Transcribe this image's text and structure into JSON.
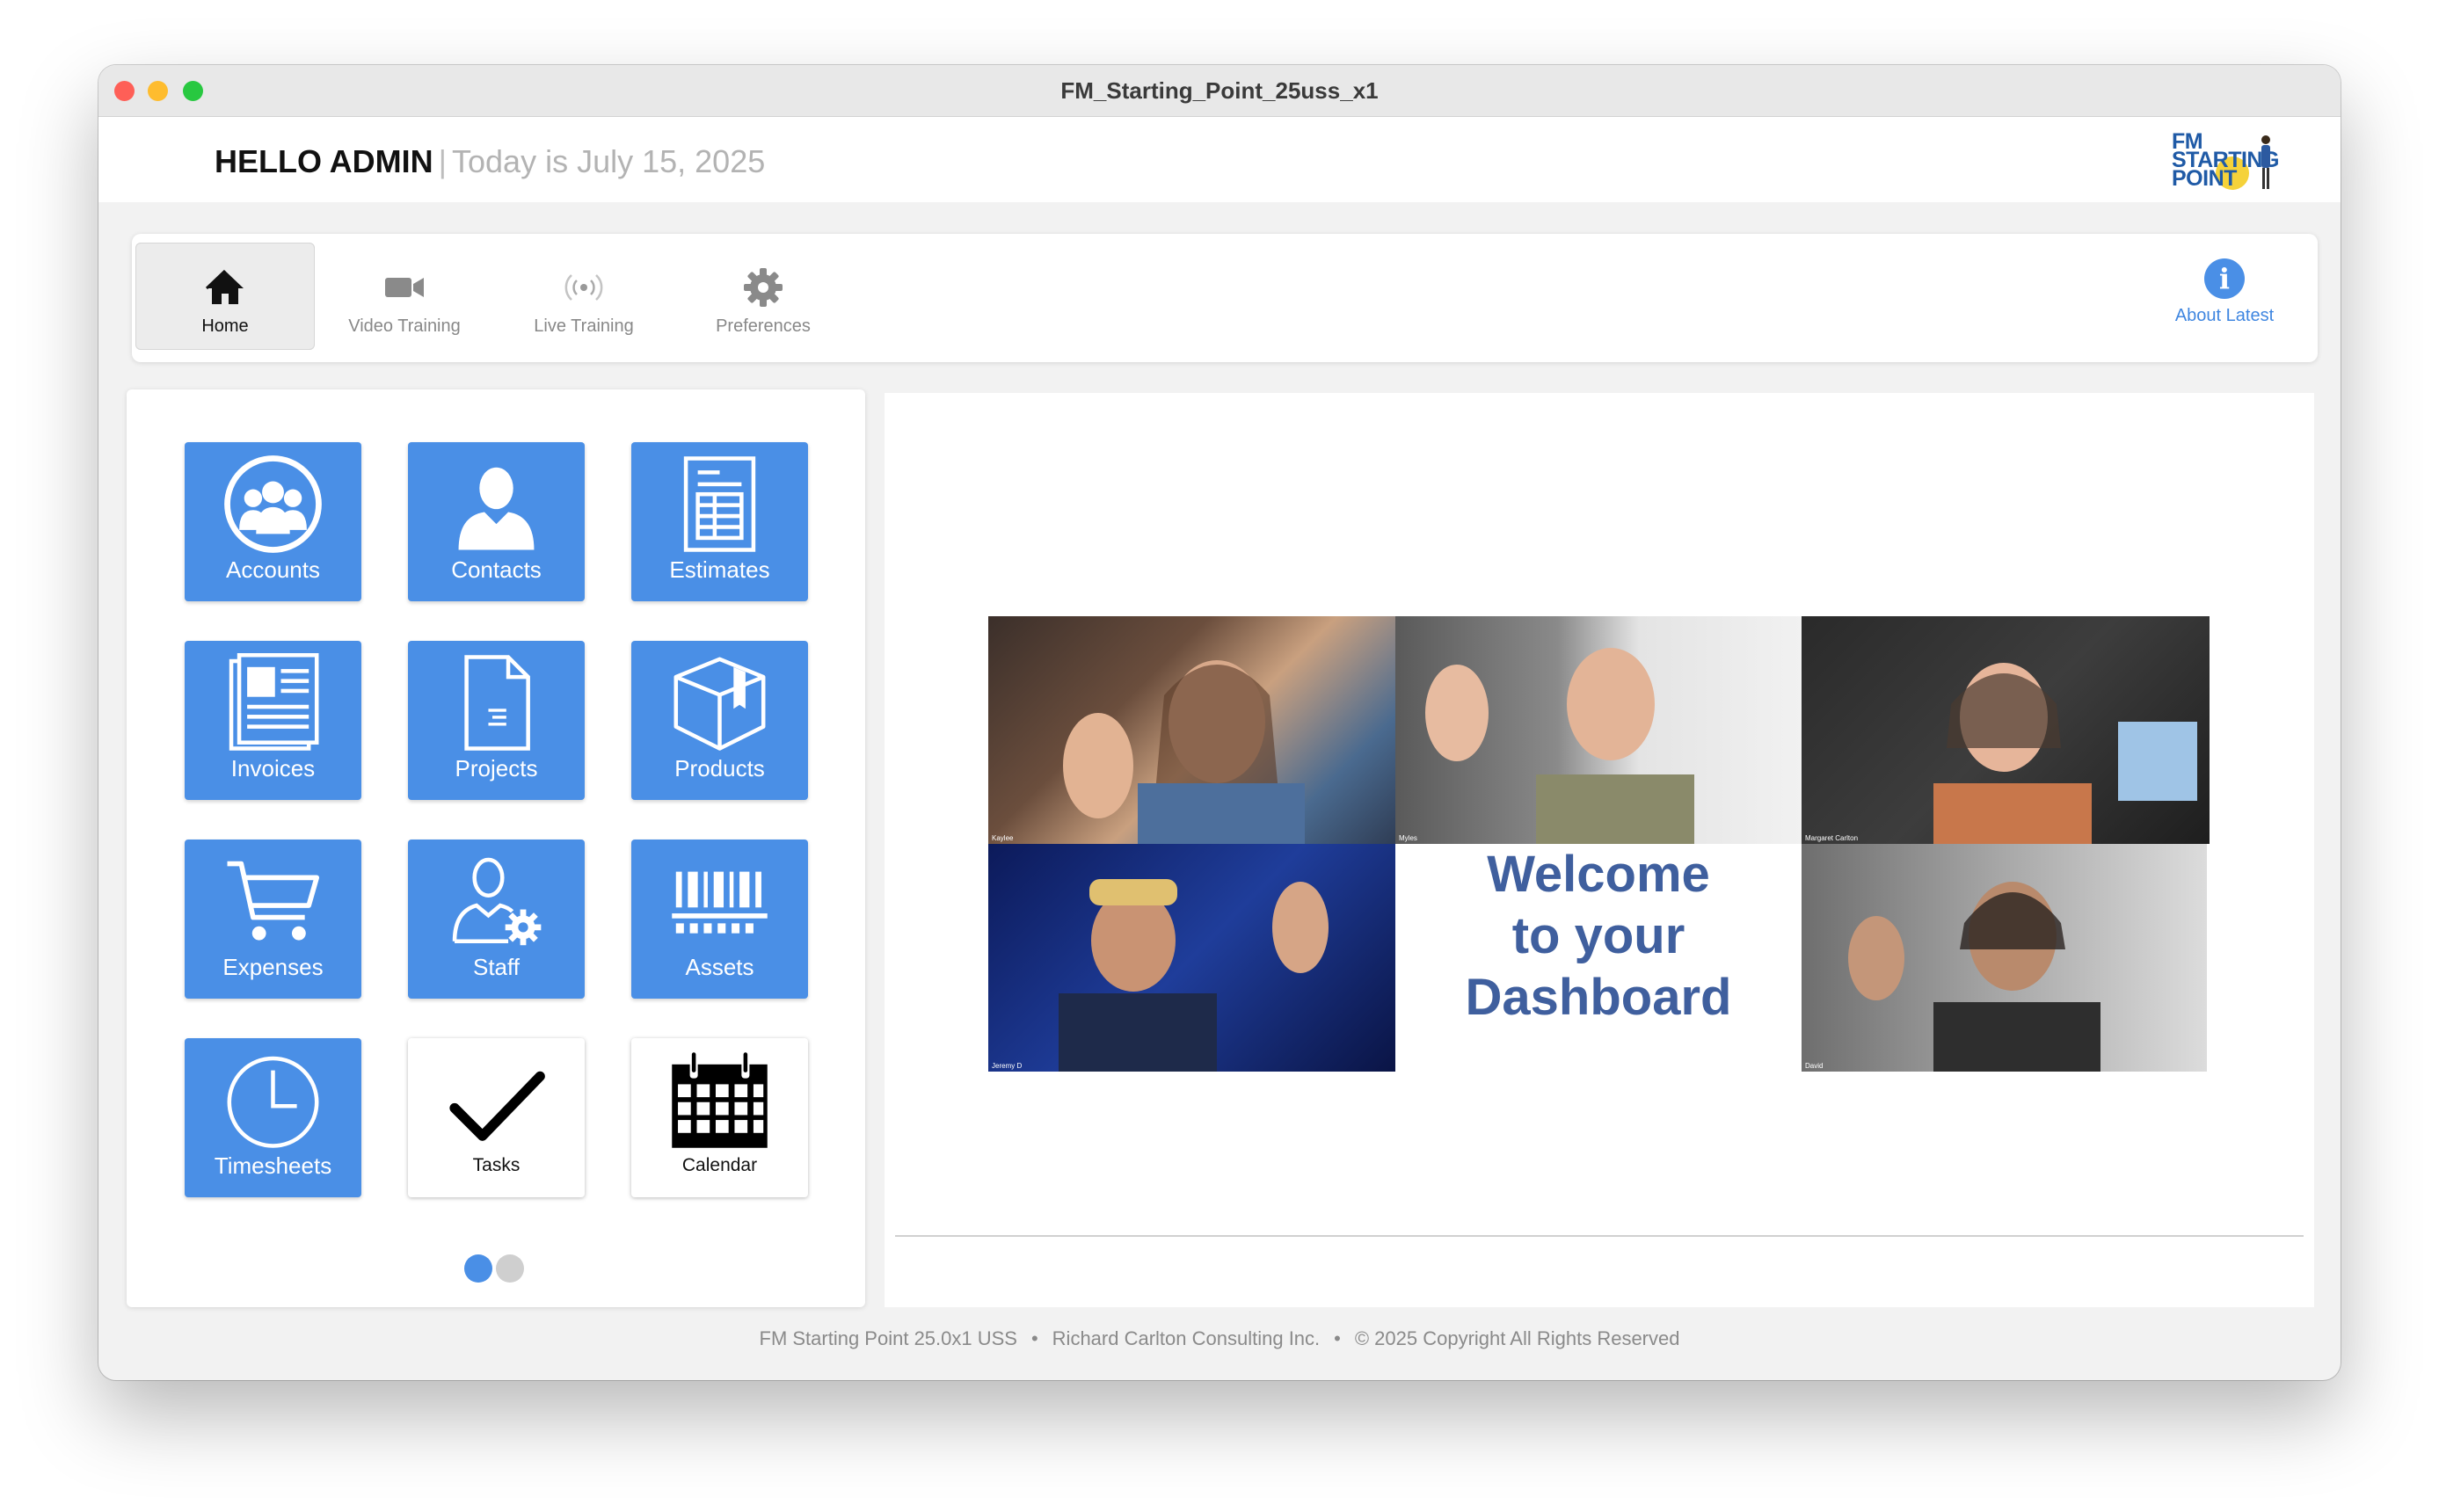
{
  "window": {
    "title": "FM_Starting_Point_25uss_x1"
  },
  "header": {
    "hello": "HELLO ADMIN",
    "separator": "|",
    "date_text": "Today is July 15, 2025",
    "logo_text": "FM STARTING POINT"
  },
  "nav": {
    "tabs": [
      {
        "label": "Home",
        "icon": "home-icon",
        "active": true
      },
      {
        "label": "Video Training",
        "icon": "video-camera-icon",
        "active": false
      },
      {
        "label": "Live Training",
        "icon": "broadcast-icon",
        "active": false
      },
      {
        "label": "Preferences",
        "icon": "gear-icon",
        "active": false
      }
    ],
    "about": {
      "label": "About Latest",
      "icon": "info-icon",
      "glyph": "i"
    }
  },
  "tiles": [
    {
      "label": "Accounts",
      "icon": "accounts-group-icon"
    },
    {
      "label": "Contacts",
      "icon": "person-icon"
    },
    {
      "label": "Estimates",
      "icon": "estimate-sheet-icon"
    },
    {
      "label": "Invoices",
      "icon": "newspaper-icon"
    },
    {
      "label": "Projects",
      "icon": "document-icon"
    },
    {
      "label": "Products",
      "icon": "box-icon"
    },
    {
      "label": "Expenses",
      "icon": "shopping-cart-icon"
    },
    {
      "label": "Staff",
      "icon": "staff-gear-icon"
    },
    {
      "label": "Assets",
      "icon": "barcode-icon"
    },
    {
      "label": "Timesheets",
      "icon": "clock-icon"
    },
    {
      "label": "Tasks",
      "icon": "checkmark-icon"
    },
    {
      "label": "Calendar",
      "icon": "calendar-icon"
    }
  ],
  "pagination": {
    "pages": 2,
    "current": 1
  },
  "banner": {
    "welcome_lines": [
      "Welcome",
      "to your",
      "Dashboard"
    ],
    "participants": [
      "Kaylee",
      "Myles",
      "Margaret Carlton",
      "Jeremy D",
      "David"
    ]
  },
  "footer": {
    "product": "FM Starting Point 25.0x1 USS",
    "bullet": "•",
    "company": "Richard Carlton Consulting Inc.",
    "copyright": "© 2025 Copyright All Rights Reserved"
  },
  "colors": {
    "accent": "#4a8fe6",
    "welcome_text": "#3f5f9e",
    "traffic_red": "#fe5f57",
    "traffic_yellow": "#febc2e",
    "traffic_green": "#28c840"
  }
}
